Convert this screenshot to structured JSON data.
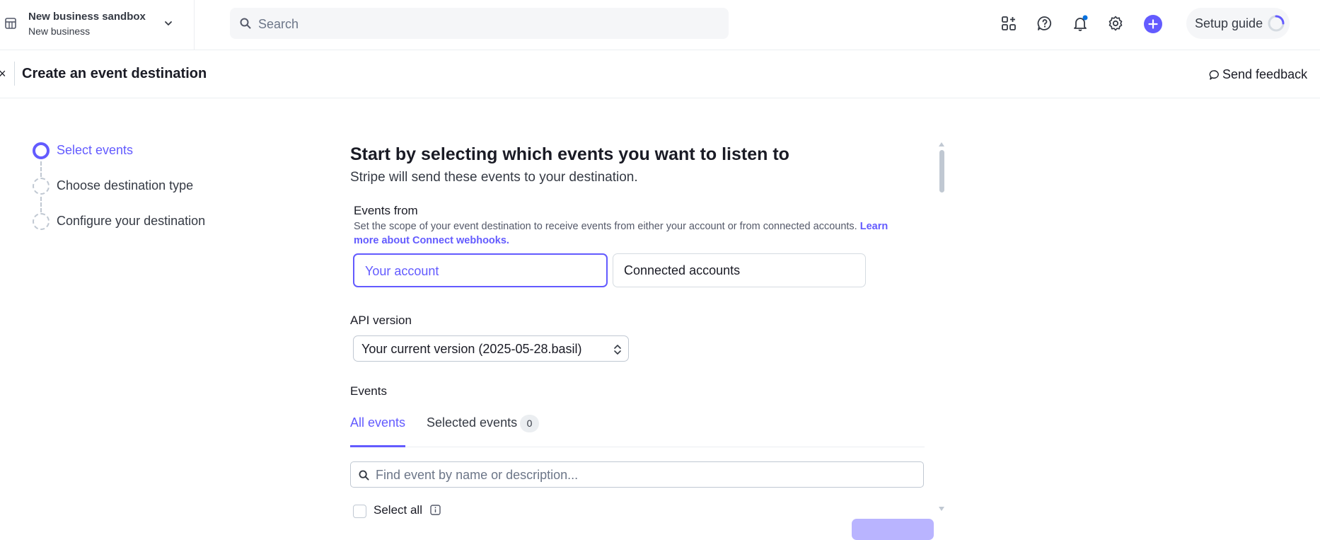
{
  "header": {
    "business_name": "New business sandbox",
    "business_sub": "New business",
    "search_placeholder": "Search",
    "setup_guide_label": "Setup guide",
    "icons": [
      "business-icon",
      "chevron-down-icon",
      "search-icon",
      "apps-icon",
      "help-icon",
      "notification-bell-icon",
      "settings-icon",
      "plus-icon",
      "progress-spinner-icon"
    ],
    "accent_color": "#635bff",
    "notification_dot_color": "#0570de"
  },
  "subheader": {
    "close_glyph": "×",
    "title": "Create an event destination",
    "feedback_label": "Send feedback"
  },
  "steps": [
    {
      "label": "Select events",
      "state": "active"
    },
    {
      "label": "Choose destination type",
      "state": "pending"
    },
    {
      "label": "Configure your destination",
      "state": "pending"
    }
  ],
  "main": {
    "heading": "Start by selecting which events you want to listen to",
    "subheading": "Stripe will send these events to your destination.",
    "events_from": {
      "label": "Events from",
      "description": "Set the scope of your event destination to receive events from either your account or from connected accounts.",
      "link_text": "Learn more about Connect webhooks.",
      "options": [
        "Your account",
        "Connected accounts"
      ],
      "selected": "Your account"
    },
    "api_version": {
      "label": "API version",
      "value": "Your current version (2025-05-28.basil)"
    },
    "events": {
      "label": "Events",
      "tabs": [
        "All events",
        "Selected events"
      ],
      "active_tab": "All events",
      "selected_count": "0",
      "find_placeholder": "Find event by name or description...",
      "select_all_label": "Select all"
    }
  }
}
